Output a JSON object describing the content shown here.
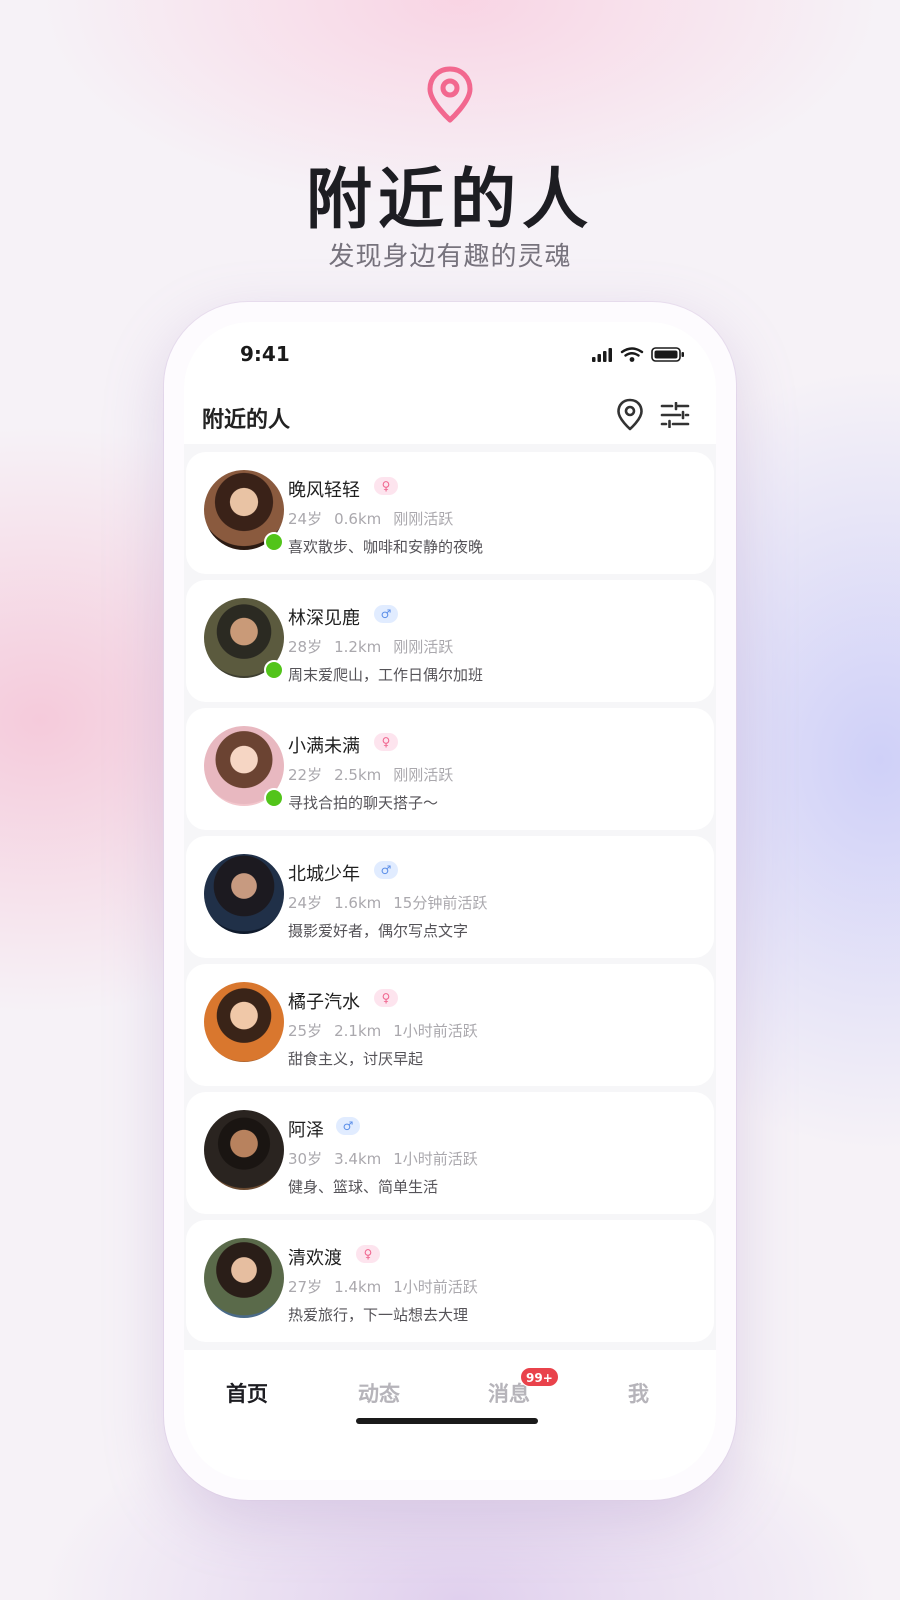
{
  "hero": {
    "title": "附近的人",
    "subtitle": "发现身边有趣的灵魂",
    "icon": "location-pin-icon",
    "accent": "#f2688f"
  },
  "status_bar": {
    "time": "9:41"
  },
  "header": {
    "title": "附近的人",
    "icons": [
      "location-pin-icon",
      "filter-sliders-icon"
    ]
  },
  "users": [
    {
      "name": "晚风轻轻",
      "gender": "♀",
      "age": "24岁",
      "distance": "0.6km",
      "active": "刚刚活跃",
      "bio": "喜欢散步、咖啡和安静的夜晚",
      "online": true
    },
    {
      "name": "林深见鹿",
      "gender": "♂",
      "age": "28岁",
      "distance": "1.2km",
      "active": "刚刚活跃",
      "bio": "周末爱爬山，工作日偶尔加班",
      "online": true
    },
    {
      "name": "小满未满",
      "gender": "♀",
      "age": "22岁",
      "distance": "2.5km",
      "active": "刚刚活跃",
      "bio": "寻找合拍的聊天搭子～",
      "online": true
    },
    {
      "name": "北城少年",
      "gender": "♂",
      "age": "24岁",
      "distance": "1.6km",
      "active": "15分钟前活跃",
      "bio": "摄影爱好者，偶尔写点文字",
      "online": false
    },
    {
      "name": "橘子汽水",
      "gender": "♀",
      "age": "25岁",
      "distance": "2.1km",
      "active": "1小时前活跃",
      "bio": "甜食主义，讨厌早起",
      "online": false
    },
    {
      "name": "阿泽",
      "gender": "♂",
      "age": "30岁",
      "distance": "3.4km",
      "active": "1小时前活跃",
      "bio": "健身、篮球、简单生活",
      "online": false
    },
    {
      "name": "清欢渡",
      "gender": "♀",
      "age": "27岁",
      "distance": "1.4km",
      "active": "1小时前活跃",
      "bio": "热爱旅行，下一站想去大理",
      "online": false
    }
  ],
  "tabbar": {
    "tabs": [
      {
        "label": "首页",
        "active": true
      },
      {
        "label": "动态",
        "active": false
      },
      {
        "label": "消息",
        "active": false
      },
      {
        "label": "我",
        "active": false
      }
    ],
    "message_badge": "99+"
  },
  "colors": {
    "online": "#52c41a",
    "female": "#f0668f",
    "male": "#5c8fe8",
    "badge": "#e9424b"
  }
}
